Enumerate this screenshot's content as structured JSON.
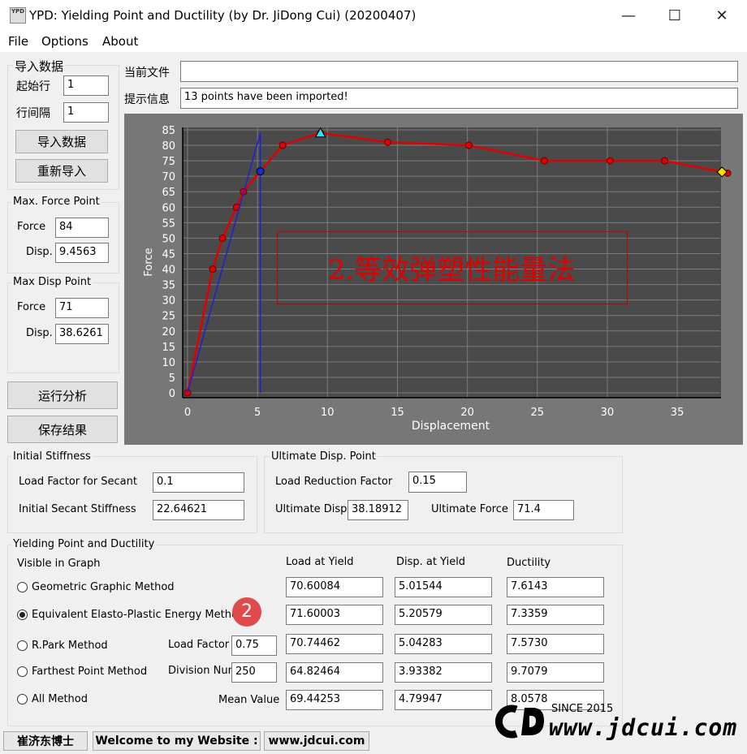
{
  "window": {
    "title": "YPD: Yielding Point and Ductility (by Dr. JiDong Cui) (20200407)",
    "icon_text": "YPD",
    "minimize": "—",
    "maximize": "☐",
    "close": "✕"
  },
  "menu": [
    "File",
    "Options",
    "About"
  ],
  "import": {
    "group_title": "导入数据",
    "start_row_label": "起始行",
    "start_row_value": "1",
    "row_interval_label": "行间隔",
    "row_interval_value": "1",
    "import_button": "导入数据",
    "reimport_button": "重新导入"
  },
  "max_force_point": {
    "group_title": "Max. Force Point",
    "force_label": "Force",
    "force_value": "84",
    "disp_label": "Disp.",
    "disp_value": "9.4563"
  },
  "max_disp_point": {
    "group_title": "Max Disp Point",
    "force_label": "Force",
    "force_value": "71",
    "disp_label": "Disp.",
    "disp_value": "38.6261"
  },
  "actions": {
    "run_button": "运行分析",
    "save_button": "保存结果"
  },
  "file": {
    "current_label": "当前文件",
    "current_value": "",
    "info_label": "提示信息",
    "info_value": "13  points have been imported!"
  },
  "chart_data": {
    "type": "line",
    "xlabel": "Displacement",
    "ylabel": "Force",
    "xlim": [
      0,
      39
    ],
    "ylim": [
      0,
      85
    ],
    "x_ticks": [
      0,
      5,
      10,
      15,
      20,
      25,
      30,
      35
    ],
    "y_ticks": [
      0,
      5,
      10,
      15,
      20,
      25,
      30,
      35,
      40,
      45,
      50,
      55,
      60,
      65,
      70,
      75,
      80,
      85
    ],
    "grid": true,
    "series": [
      {
        "color": "#e00000",
        "style": "line-markers",
        "x": [
          0,
          1.8,
          2.5,
          3.5,
          4.0,
          5.2,
          6.8,
          9.5,
          14.3,
          20.1,
          25.5,
          30.2,
          34.1,
          38.6
        ],
        "y": [
          0,
          40,
          50,
          60,
          65,
          71.6,
          80,
          84,
          81,
          80,
          75,
          75,
          75,
          71
        ]
      },
      {
        "color": "#2020d0",
        "style": "line",
        "x": [
          0,
          5.2,
          5.2
        ],
        "y": [
          0,
          84,
          0
        ]
      }
    ],
    "special_points": [
      {
        "marker": "blue-circle",
        "x": 5.2,
        "y": 71.6
      },
      {
        "marker": "cyan-triangle",
        "x": 9.5,
        "y": 84
      },
      {
        "marker": "yellow-diamond",
        "x": 38.2,
        "y": 71.4
      }
    ],
    "annotation": "2.等效弹塑性能量法"
  },
  "initial_stiffness": {
    "group_title": "Initial Stiffness",
    "load_factor_label": "Load Factor for Secant",
    "load_factor_value": "0.1",
    "secant_label": "Initial Secant Stiffness",
    "secant_value": "22.64621"
  },
  "ultimate": {
    "group_title": "Ultimate Disp. Point",
    "reduction_label": "Load Reduction Factor",
    "reduction_value": "0.15",
    "disp_label": "Ultimate Disp.",
    "disp_value": "38.18912",
    "force_label": "Ultimate Force",
    "force_value": "71.4"
  },
  "yielding": {
    "group_title": "Yielding Point and Ductility",
    "visible_label": "Visible in Graph",
    "col_load": "Load at Yield",
    "col_disp": "Disp. at Yield",
    "col_duct": "Ductility",
    "rows": [
      {
        "method": "Geometric Graphic Method",
        "load": "70.60084",
        "disp": "5.01544",
        "duct": "7.6143"
      },
      {
        "method": "Equivalent Elasto-Plastic Energy Method",
        "load": "71.60003",
        "disp": "5.20579",
        "duct": "7.3359"
      },
      {
        "method": "R.Park Method",
        "param_label": "Load Factor",
        "param_value": "0.75",
        "load": "70.74462",
        "disp": "5.04283",
        "duct": "7.5730"
      },
      {
        "method": "Farthest Point Method",
        "param_label": "Division Num",
        "param_value": "250",
        "load": "64.82464",
        "disp": "3.93382",
        "duct": "9.7079"
      },
      {
        "method": "All Method",
        "param_label": "Mean Value",
        "load": "69.44253",
        "disp": "4.79947",
        "duct": "8.0578"
      }
    ],
    "selected": 1,
    "badge": "2"
  },
  "status": {
    "author": "崔济东博士",
    "welcome": "Welcome to my Website :",
    "site": "www.jdcui.com"
  },
  "watermark": {
    "since": "SINCE 2015",
    "text": "www.jdcui.com"
  }
}
